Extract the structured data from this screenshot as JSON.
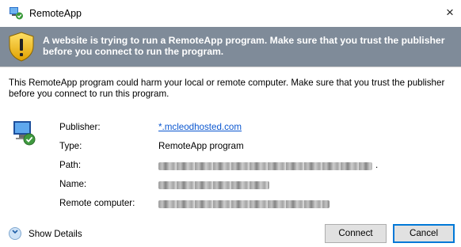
{
  "window": {
    "title": "RemoteApp",
    "close_glyph": "×"
  },
  "banner": {
    "text": "A website is trying to run a RemoteApp program. Make sure that you trust the publisher before you connect to run the program.",
    "icon": "shield-warning-icon"
  },
  "warning_text": "This RemoteApp program could harm your local or remote computer. Make sure that you trust the publisher before you connect to run this program.",
  "details": {
    "icon": "remote-computer-icon",
    "publisher_label": "Publisher:",
    "publisher_value": "*.mcleodhosted.com",
    "type_label": "Type:",
    "type_value": "RemoteApp program",
    "path_label": "Path:",
    "path_value_suffix": ".",
    "name_label": "Name:",
    "remote_computer_label": "Remote computer:"
  },
  "footer": {
    "show_details_label": "Show Details",
    "show_details_icon": "chevron-down-icon",
    "connect_label": "Connect",
    "cancel_label": "Cancel"
  },
  "colors": {
    "banner_bg": "#7f8b99",
    "link": "#0b57d0",
    "default_button_border": "#0078d7"
  }
}
